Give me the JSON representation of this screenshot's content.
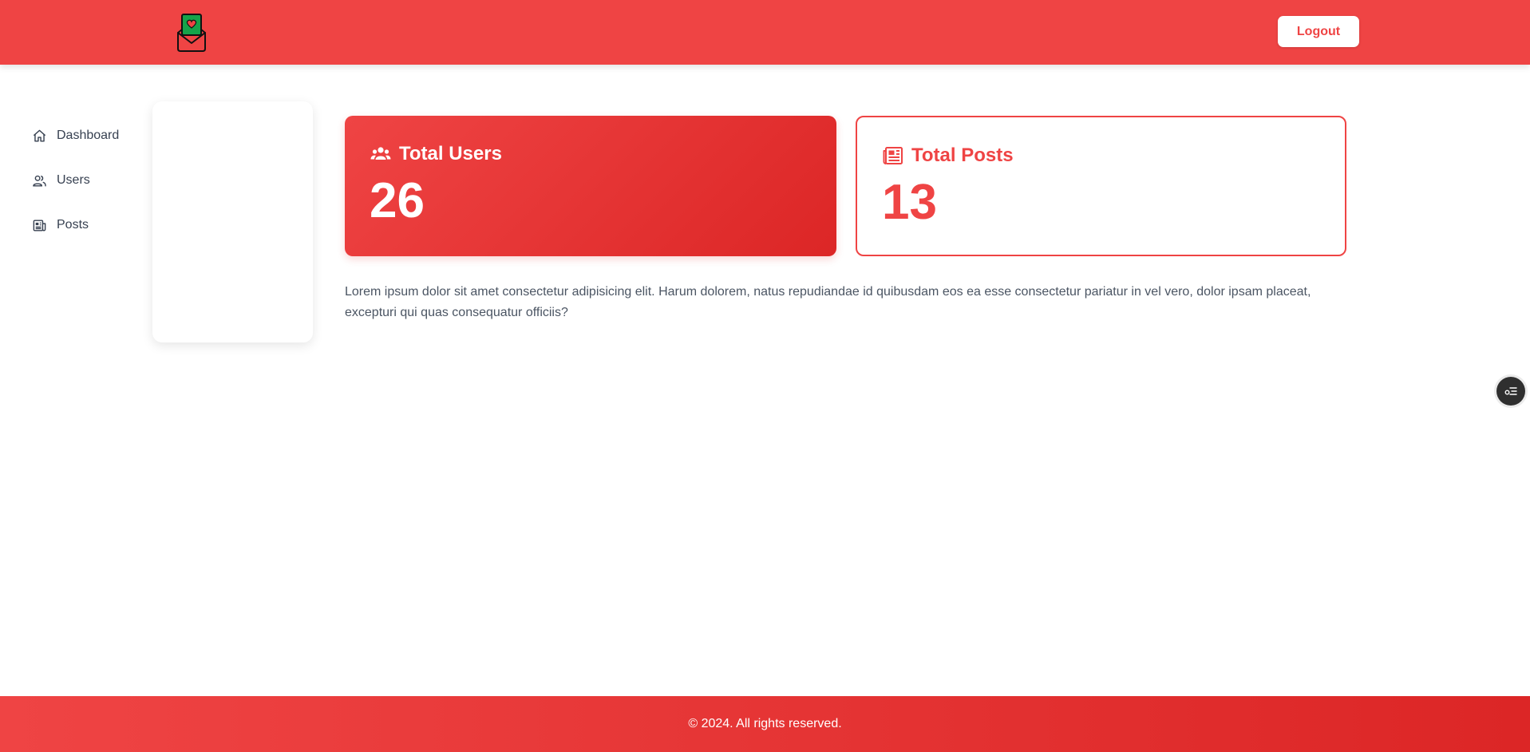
{
  "header": {
    "logo_icon": "envelope-heart-logo",
    "logout_label": "Logout"
  },
  "sidebar": {
    "items": [
      {
        "label": "Dashboard",
        "icon": "home-icon"
      },
      {
        "label": "Users",
        "icon": "users-icon"
      },
      {
        "label": "Posts",
        "icon": "newspaper-icon"
      }
    ]
  },
  "cards": {
    "users": {
      "title": "Total Users",
      "value": "26",
      "icon": "users-group-icon"
    },
    "posts": {
      "title": "Total Posts",
      "value": "13",
      "icon": "newspaper-icon"
    }
  },
  "main": {
    "description": "Lorem ipsum dolor sit amet consectetur adipisicing elit. Harum dolorem, natus repudiandae id quibusdam eos ea esse consectetur pariatur in vel vero, dolor ipsam placeat, excepturi qui quas consequatur officiis?"
  },
  "footer": {
    "copyright": "© 2024. All rights reserved."
  },
  "colors": {
    "primary": "#ef4444",
    "primary_dark": "#dc2626",
    "text": "#374151"
  }
}
